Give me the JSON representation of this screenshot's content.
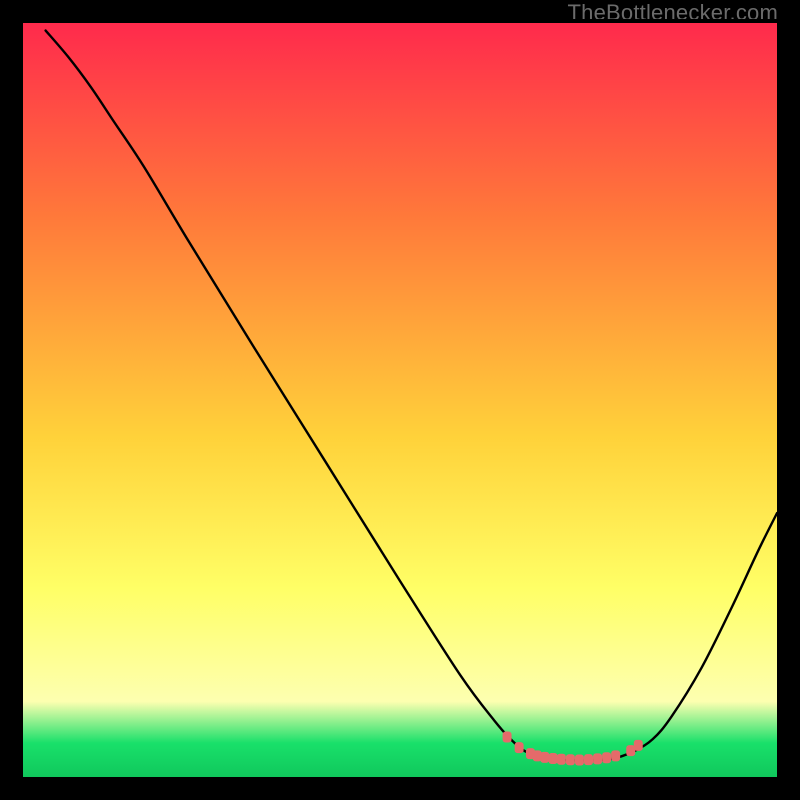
{
  "watermark": "TheBottlenecker.com",
  "colors": {
    "top": "#ff2a4c",
    "mid_high": "#ff7a3a",
    "mid": "#ffd23a",
    "low": "#ffff66",
    "vlow": "#fdffb0",
    "green": "#19e06a",
    "green_deep": "#10c85c",
    "curve": "#000000",
    "marker": "#e56a6a",
    "frame": "#000000"
  },
  "chart_data": {
    "type": "line",
    "title": "",
    "xlabel": "",
    "ylabel": "",
    "xlim": [
      0,
      100
    ],
    "ylim": [
      0,
      100
    ],
    "curve": [
      {
        "x": 3.0,
        "y": 99.0
      },
      {
        "x": 6.0,
        "y": 95.5
      },
      {
        "x": 9.0,
        "y": 91.5
      },
      {
        "x": 12.0,
        "y": 87.0
      },
      {
        "x": 16.0,
        "y": 81.0
      },
      {
        "x": 22.0,
        "y": 71.0
      },
      {
        "x": 30.0,
        "y": 58.0
      },
      {
        "x": 40.0,
        "y": 42.0
      },
      {
        "x": 50.0,
        "y": 26.0
      },
      {
        "x": 58.0,
        "y": 13.5
      },
      {
        "x": 62.5,
        "y": 7.5
      },
      {
        "x": 65.0,
        "y": 4.7
      },
      {
        "x": 67.0,
        "y": 3.2
      },
      {
        "x": 70.0,
        "y": 2.4
      },
      {
        "x": 74.0,
        "y": 2.2
      },
      {
        "x": 78.0,
        "y": 2.4
      },
      {
        "x": 81.0,
        "y": 3.4
      },
      {
        "x": 83.5,
        "y": 5.0
      },
      {
        "x": 86.0,
        "y": 8.0
      },
      {
        "x": 90.0,
        "y": 14.5
      },
      {
        "x": 94.0,
        "y": 22.5
      },
      {
        "x": 97.5,
        "y": 30.0
      },
      {
        "x": 100.0,
        "y": 35.0
      }
    ],
    "markers": [
      {
        "x": 64.2,
        "y": 5.3
      },
      {
        "x": 65.8,
        "y": 3.9
      },
      {
        "x": 67.3,
        "y": 3.1
      },
      {
        "x": 68.2,
        "y": 2.8
      },
      {
        "x": 69.2,
        "y": 2.6
      },
      {
        "x": 70.3,
        "y": 2.45
      },
      {
        "x": 71.4,
        "y": 2.35
      },
      {
        "x": 72.6,
        "y": 2.28
      },
      {
        "x": 73.8,
        "y": 2.25
      },
      {
        "x": 75.0,
        "y": 2.3
      },
      {
        "x": 76.2,
        "y": 2.4
      },
      {
        "x": 77.4,
        "y": 2.55
      },
      {
        "x": 78.6,
        "y": 2.8
      },
      {
        "x": 80.6,
        "y": 3.5
      },
      {
        "x": 81.6,
        "y": 4.2
      }
    ],
    "bg_gradient_stops": [
      {
        "offset": 0.0,
        "color_key": "top"
      },
      {
        "offset": 0.26,
        "color_key": "mid_high"
      },
      {
        "offset": 0.55,
        "color_key": "mid"
      },
      {
        "offset": 0.75,
        "color_key": "low"
      },
      {
        "offset": 0.9,
        "color_key": "vlow"
      },
      {
        "offset": 0.955,
        "color_key": "green"
      },
      {
        "offset": 1.0,
        "color_key": "green_deep"
      }
    ]
  }
}
